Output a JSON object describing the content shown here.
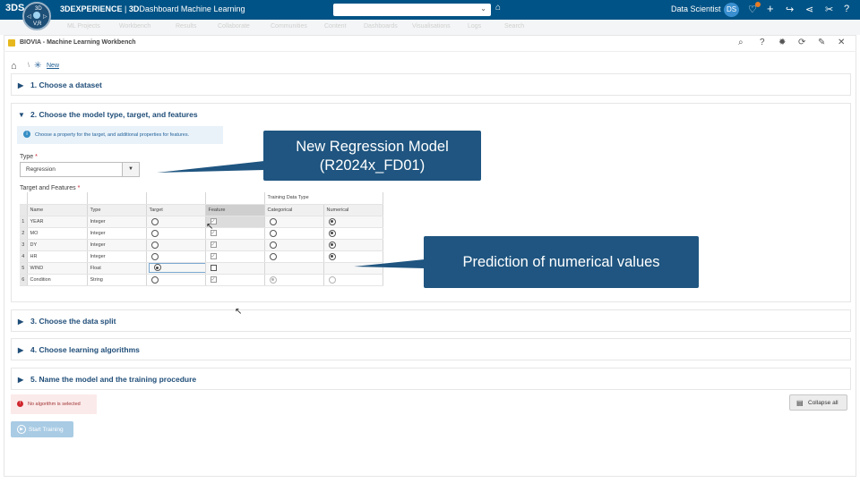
{
  "topbar": {
    "logo": "3DS",
    "compass": {
      "n": "3D",
      "e": "▷",
      "w": "◁",
      "v": "V,R"
    },
    "brand": "3DEXPERIENCE",
    "separator": " | ",
    "app_prefix": "3D",
    "app_name": "Dashboard",
    "app_sub": " Machine Learning",
    "user_role": "Data Scientist",
    "avatar": "DS",
    "icons": [
      "tag-icon",
      "notifications-icon",
      "add-icon",
      "share-icon",
      "network-icon",
      "tools-icon",
      "help-icon"
    ]
  },
  "subbar": {
    "items": [
      "ML Projects",
      "Workbench",
      "Results",
      "Collaborate",
      "Communities",
      "Content",
      "Dashboards",
      "Visualisations",
      "Logs",
      "Search"
    ]
  },
  "workbench": {
    "title": "BIOVIA - Machine Learning Workbench"
  },
  "breadcrumb": {
    "sep": "\\",
    "current": "New"
  },
  "steps": [
    {
      "label": "1. Choose a dataset",
      "expanded": false
    },
    {
      "label": "2. Choose the model type, target, and features",
      "expanded": true
    },
    {
      "label": "3. Choose the data split",
      "expanded": false
    },
    {
      "label": "4. Choose learning algorithms",
      "expanded": false
    },
    {
      "label": "5. Name the model and the training procedure",
      "expanded": false
    }
  ],
  "step2": {
    "info": "Choose a property for the target, and additional properties for features.",
    "type_label": "Type",
    "required": "*",
    "type_value": "Regression",
    "tf_label": "Target and Features",
    "group_header": "Training Data Type",
    "columns": [
      "Name",
      "Type",
      "Target",
      "Feature",
      "Categorical",
      "Numerical"
    ],
    "rows": [
      {
        "num": "1",
        "name": "YEAR",
        "type": "Integer",
        "target": false,
        "feature": true,
        "feature_disabled": true,
        "categorical": false,
        "numerical": true,
        "tdt": true
      },
      {
        "num": "2",
        "name": "MO",
        "type": "Integer",
        "target": false,
        "feature": true,
        "feature_disabled": false,
        "categorical": false,
        "numerical": true,
        "tdt": true
      },
      {
        "num": "3",
        "name": "DY",
        "type": "Integer",
        "target": false,
        "feature": true,
        "feature_disabled": false,
        "categorical": false,
        "numerical": true,
        "tdt": true
      },
      {
        "num": "4",
        "name": "HR",
        "type": "Integer",
        "target": false,
        "feature": true,
        "feature_disabled": false,
        "categorical": false,
        "numerical": true,
        "tdt": true
      },
      {
        "num": "5",
        "name": "WIND",
        "type": "Float",
        "target": true,
        "feature": false,
        "feature_disabled": false,
        "categorical": false,
        "numerical": false,
        "tdt": false
      },
      {
        "num": "6",
        "name": "Condition",
        "type": "String",
        "target": false,
        "feature": true,
        "feature_disabled": false,
        "categorical": true,
        "numerical": false,
        "tdt": true,
        "tdt_disabled": true
      }
    ]
  },
  "callouts": {
    "model_line1": "New Regression Model",
    "model_line2": "(R2024x_FD01)",
    "prediction": "Prediction of numerical values"
  },
  "alert": {
    "text": "No algorithm is selected"
  },
  "buttons": {
    "collapse_all": "Collapse all",
    "start_training": "Start Training"
  },
  "colors": {
    "topbar": "#005386",
    "callout": "#1f5580",
    "step_header": "#1f4d78",
    "alert_bg": "#fbeaea",
    "start_button": "#a9cbe4"
  }
}
